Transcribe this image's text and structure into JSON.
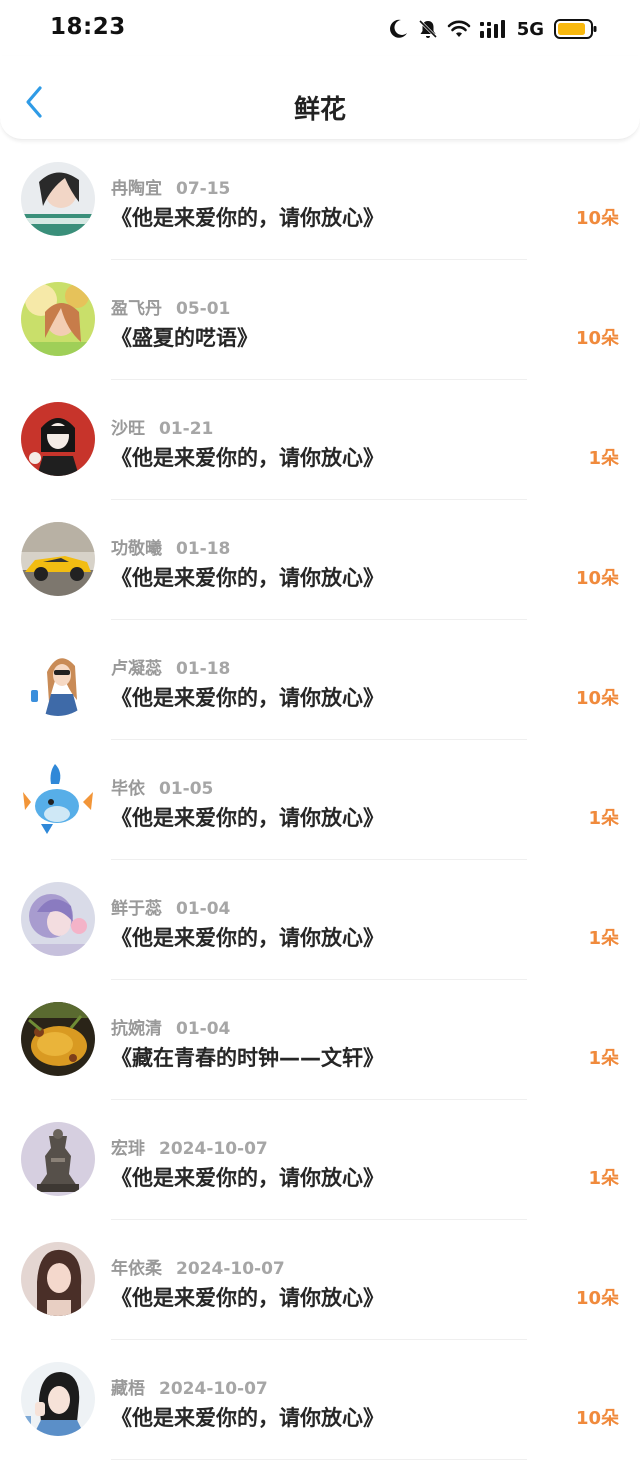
{
  "status_bar": {
    "time": "18:23",
    "network": "5G",
    "icons": [
      "moon-icon",
      "bell-muted-icon",
      "wifi-icon",
      "signal-icon",
      "battery-icon"
    ],
    "battery_color": "#F9B90F"
  },
  "header": {
    "title": "鲜花",
    "back_icon": "chevron-left-icon",
    "accent_color": "#2F9BE6"
  },
  "count_color": "#F08A3C",
  "items": [
    {
      "name": "冉陶宜",
      "date": "07-15",
      "book": "《他是来爱你的，请你放心》",
      "count": "10朵"
    },
    {
      "name": "盈飞丹",
      "date": "05-01",
      "book": "《盛夏的呓语》",
      "count": "10朵"
    },
    {
      "name": "沙旺",
      "date": "01-21",
      "book": "《他是来爱你的，请你放心》",
      "count": "1朵"
    },
    {
      "name": "功敬曦",
      "date": "01-18",
      "book": "《他是来爱你的，请你放心》",
      "count": "10朵"
    },
    {
      "name": "卢凝蕊",
      "date": "01-18",
      "book": "《他是来爱你的，请你放心》",
      "count": "10朵"
    },
    {
      "name": "毕依",
      "date": "01-05",
      "book": "《他是来爱你的，请你放心》",
      "count": "1朵"
    },
    {
      "name": "鲜于蕊",
      "date": "01-04",
      "book": "《他是来爱你的，请你放心》",
      "count": "1朵"
    },
    {
      "name": "抗婉清",
      "date": "01-04",
      "book": "《藏在青春的时钟——文轩》",
      "count": "1朵"
    },
    {
      "name": "宏琲",
      "date": "2024-10-07",
      "book": "《他是来爱你的，请你放心》",
      "count": "1朵"
    },
    {
      "name": "年依柔",
      "date": "2024-10-07",
      "book": "《他是来爱你的，请你放心》",
      "count": "10朵"
    },
    {
      "name": "藏梧",
      "date": "2024-10-07",
      "book": "《他是来爱你的，请你放心》",
      "count": "10朵"
    }
  ]
}
